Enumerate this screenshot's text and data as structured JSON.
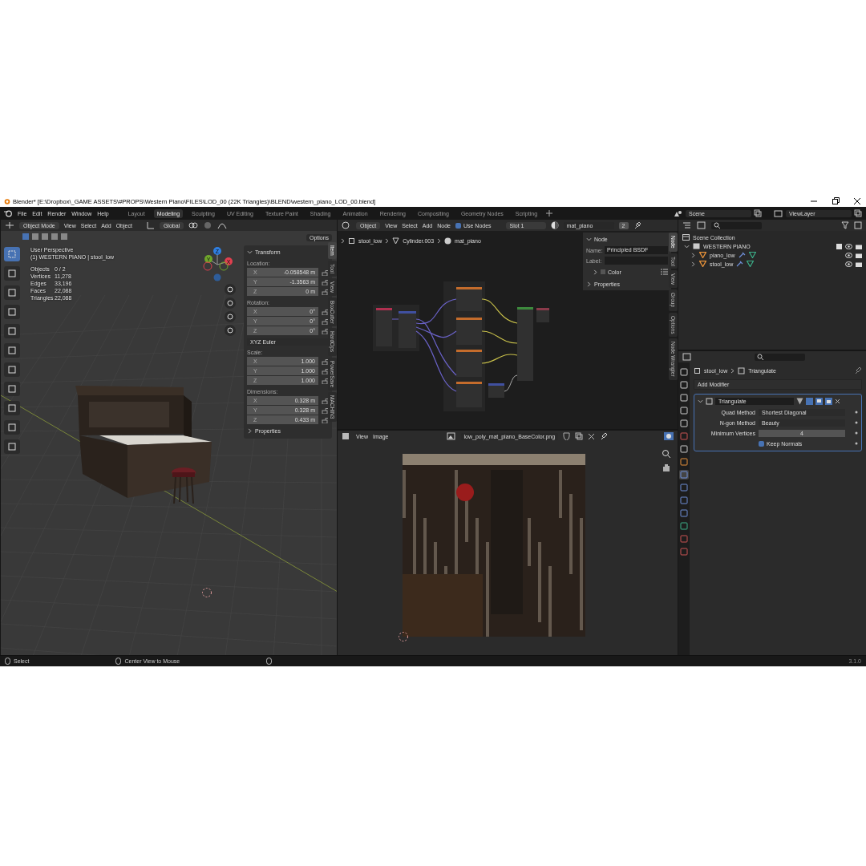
{
  "window": {
    "title": "Blender* [E:\\Dropbox\\_GAME ASSETS\\#PROPS\\Western Piano\\FILES\\LOD_00 (22K Triangles)\\BLEND\\western_piano_LOD_00.blend]"
  },
  "menu": [
    "File",
    "Edit",
    "Render",
    "Window",
    "Help"
  ],
  "workspaces": [
    {
      "label": "Layout",
      "selected": false
    },
    {
      "label": "Modeling",
      "selected": true
    },
    {
      "label": "Sculpting",
      "selected": false
    },
    {
      "label": "UV Editing",
      "selected": false
    },
    {
      "label": "Texture Paint",
      "selected": false
    },
    {
      "label": "Shading",
      "selected": false
    },
    {
      "label": "Animation",
      "selected": false
    },
    {
      "label": "Rendering",
      "selected": false
    },
    {
      "label": "Compositing",
      "selected": false
    },
    {
      "label": "Geometry Nodes",
      "selected": false
    },
    {
      "label": "Scripting",
      "selected": false
    }
  ],
  "scene": "Scene",
  "view_layer": "ViewLayer",
  "viewport": {
    "mode": "Object Mode",
    "menus": [
      "View",
      "Select",
      "Add",
      "Object"
    ],
    "orientation": "Global",
    "options": "Options",
    "overlay": {
      "title": "User Perspective",
      "context": "(1) WESTERN PIANO | stool_low",
      "stats": [
        {
          "label": "Objects",
          "value": "0 / 2"
        },
        {
          "label": "Vertices",
          "value": "11,278"
        },
        {
          "label": "Edges",
          "value": "33,196"
        },
        {
          "label": "Faces",
          "value": "22,088"
        },
        {
          "label": "Triangles",
          "value": "22,088"
        }
      ]
    },
    "gizmo": [
      {
        "axis": "Z",
        "color": "#2f7ee0"
      },
      {
        "axis": "Y",
        "color": "#6fa62b"
      },
      {
        "axis": "X",
        "color": "#e0404f"
      }
    ],
    "sidebar": {
      "tabs": [
        {
          "label": "Item",
          "selected": true
        },
        {
          "label": "Tool",
          "selected": false
        },
        {
          "label": "View",
          "selected": false
        },
        {
          "label": "BoxCutter",
          "selected": false
        },
        {
          "label": "HardOps",
          "selected": false
        },
        {
          "label": "PowerSave",
          "selected": false
        },
        {
          "label": "MACHIN3",
          "selected": false
        }
      ],
      "panels": [
        {
          "title": "Transform",
          "expanded": true,
          "groups": [
            {
              "label": "Location:",
              "fields": [
                {
                  "axis": "X",
                  "value": "-0.058548 m"
                },
                {
                  "axis": "Y",
                  "value": "-1.3563 m"
                },
                {
                  "axis": "Z",
                  "value": "0 m"
                }
              ]
            },
            {
              "label": "Rotation:",
              "fields": [
                {
                  "axis": "X",
                  "value": "0°"
                },
                {
                  "axis": "Y",
                  "value": "0°"
                },
                {
                  "axis": "Z",
                  "value": "0°"
                }
              ],
              "mode": "XYZ Euler"
            },
            {
              "label": "Scale:",
              "fields": [
                {
                  "axis": "X",
                  "value": "1.000"
                },
                {
                  "axis": "Y",
                  "value": "1.000"
                },
                {
                  "axis": "Z",
                  "value": "1.000"
                }
              ]
            },
            {
              "label": "Dimensions:",
              "fields": [
                {
                  "axis": "X",
                  "value": "0.328 m"
                },
                {
                  "axis": "Y",
                  "value": "0.328 m"
                },
                {
                  "axis": "Z",
                  "value": "0.433 m"
                }
              ]
            }
          ]
        },
        {
          "title": "Properties",
          "expanded": false
        }
      ]
    }
  },
  "node_editor": {
    "object": "Object",
    "menus": [
      "View",
      "Select",
      "Add",
      "Node"
    ],
    "use_nodes": {
      "label": "Use Nodes",
      "checked": true
    },
    "slot": "Slot 1",
    "material": "mat_piano",
    "users": "2",
    "breadcrumbs": [
      {
        "kind": "object",
        "label": "stool_low"
      },
      {
        "kind": "mesh",
        "label": "Cylinder.003"
      },
      {
        "kind": "material",
        "label": "mat_piano"
      }
    ],
    "sidebar": {
      "tabs": [
        {
          "label": "Node",
          "selected": true
        },
        {
          "label": "Tool",
          "selected": false
        },
        {
          "label": "View",
          "selected": false
        },
        {
          "label": "Group",
          "selected": false
        },
        {
          "label": "Options",
          "selected": false
        },
        {
          "label": "Node Wrangler",
          "selected": false
        }
      ],
      "panel": {
        "title": "Node",
        "expanded": true
      },
      "name_label": "Name:",
      "name": "Principled BSDF",
      "label_label": "Label:",
      "color": {
        "label": "Color",
        "expanded": false
      },
      "properties": {
        "title": "Properties",
        "expanded": false
      }
    }
  },
  "image_editor": {
    "menus": [
      "View",
      "Image"
    ],
    "image": "low_poly_mat_piano_BaseColor.png"
  },
  "outliner": {
    "root": "Scene Collection",
    "children": [
      {
        "name": "WESTERN PIANO",
        "kind": "collection",
        "expanded": true,
        "children": [
          {
            "name": "piano_low",
            "kind": "mesh",
            "expanded": false
          },
          {
            "name": "stool_low",
            "kind": "mesh",
            "expanded": false
          }
        ]
      }
    ]
  },
  "properties": {
    "breadcrumbs": [
      "stool_low",
      "Triangulate"
    ],
    "add_modifier": "Add Modifier",
    "modifier": {
      "name": "Triangulate",
      "expanded": true,
      "fields": [
        {
          "kind": "dropdown",
          "label": "Quad Method",
          "value": "Shortest Diagonal"
        },
        {
          "kind": "dropdown",
          "label": "N-gon Method",
          "value": "Beauty"
        },
        {
          "kind": "number",
          "label": "Minimum Vertices",
          "value": "4"
        },
        {
          "kind": "checkbox",
          "label": "Keep Normals",
          "checked": true
        }
      ]
    }
  },
  "status_bar": {
    "items": [
      "Select",
      "Center View to Mouse"
    ],
    "version": "3.1.0"
  }
}
